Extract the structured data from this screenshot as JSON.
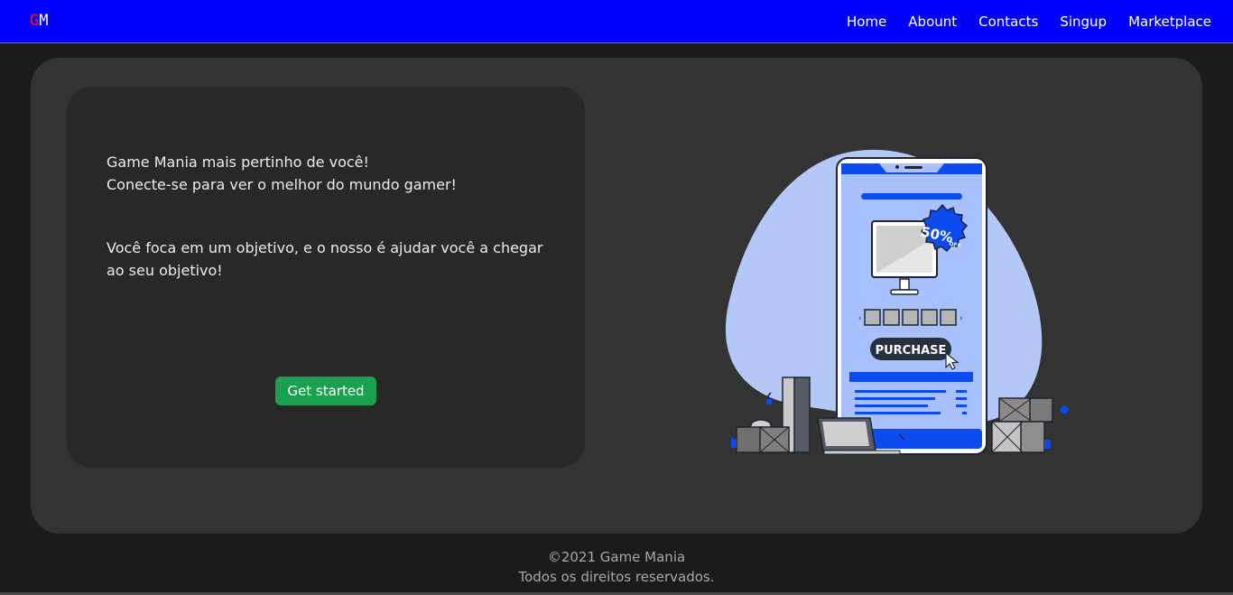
{
  "brand": {
    "letter_g": "G",
    "letter_m": "M",
    "colors": {
      "g": "#ff1a1a",
      "m": "#ffffff",
      "navbar": "#0000ff"
    }
  },
  "nav": {
    "items": [
      {
        "label": "Home"
      },
      {
        "label": "Abount"
      },
      {
        "label": "Contacts"
      },
      {
        "label": "Singup"
      },
      {
        "label": "Marketplace"
      }
    ]
  },
  "hero": {
    "line1": "Game Mania mais pertinho de você!",
    "line2": "Conecte-se para ver o melhor do mundo gamer!",
    "paragraph2": "Você foca em um objetivo, e o nosso é ajudar você a chegar ao seu objetivo!",
    "cta_label": "Get started",
    "cta_color": "#1aa14f"
  },
  "illustration": {
    "discount": "50%",
    "discount_suffix": "OFF",
    "purchase_label": "PURCHASE"
  },
  "footer": {
    "copyright": "©2021 Game Mania",
    "rights": "Todos os direitos reservados."
  }
}
